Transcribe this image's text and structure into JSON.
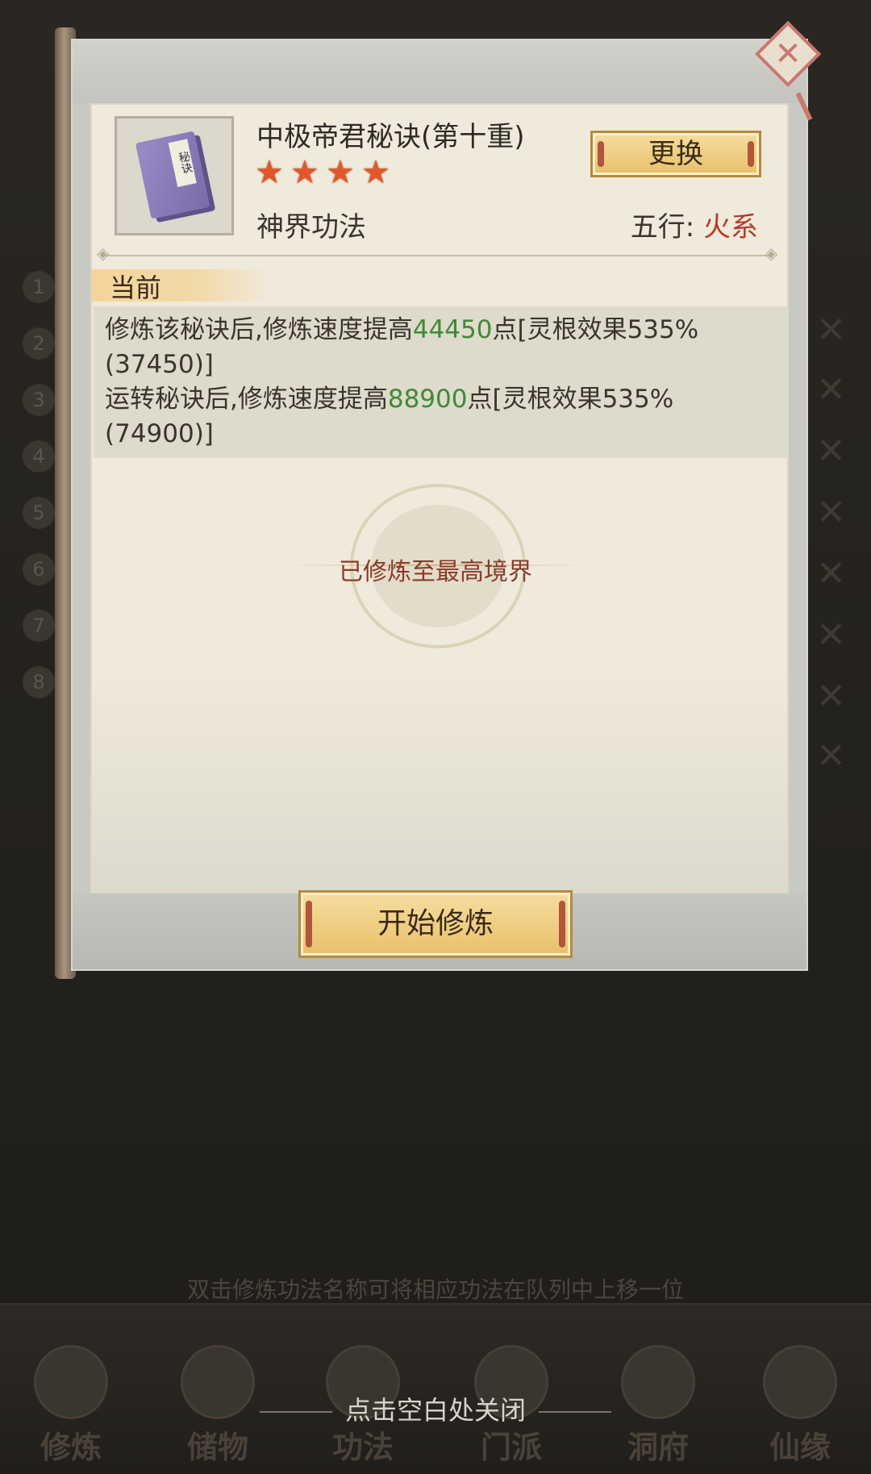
{
  "background": {
    "side_numbers": [
      "1",
      "2",
      "3",
      "4",
      "5",
      "6",
      "7",
      "8"
    ]
  },
  "modal": {
    "close_icon": "close-x-icon",
    "item": {
      "icon": "secret-manual-book-icon",
      "icon_text": "秘诀",
      "name": "中极帝君秘诀(第十重)",
      "star_count": 4,
      "star_glyph": "★",
      "type": "神界功法",
      "element_label": "五行:",
      "element_value": "火系"
    },
    "swap_button": "更换",
    "section_title": "当前",
    "description": {
      "line1_prefix": "修炼该秘诀后,修炼速度提高",
      "line1_value": "44450",
      "line1_suffix": "点[灵根效果535%(37450)]",
      "line2_prefix": "运转秘诀后,修炼速度提高",
      "line2_value": "88900",
      "line2_suffix": "点[灵根效果535%(74900)]"
    },
    "status_text": "已修炼至最高境界",
    "start_button": "开始修炼"
  },
  "hint_text": "双击修炼功法名称可将相应功法在队列中上移一位",
  "bottom_nav": [
    {
      "label": "修炼"
    },
    {
      "label": "储物"
    },
    {
      "label": "功法"
    },
    {
      "label": "门派"
    },
    {
      "label": "洞府"
    },
    {
      "label": "仙缘"
    }
  ],
  "close_tip": "点击空白处关闭",
  "colors": {
    "accent_green": "#3f8a33",
    "accent_red": "#b13c2c",
    "star": "#e2572a",
    "button_gold": "#e8c06b"
  }
}
